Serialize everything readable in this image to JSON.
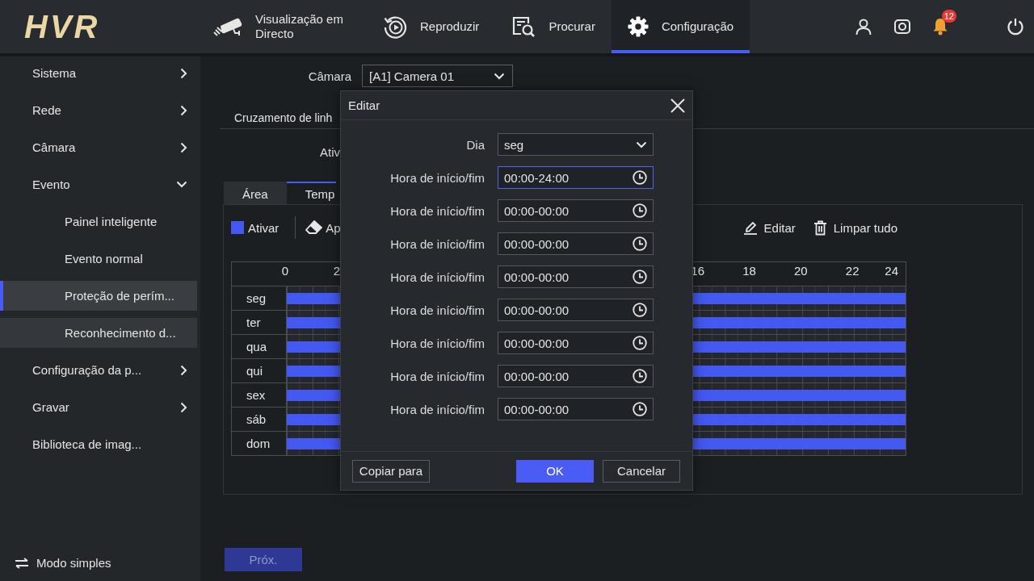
{
  "logo": "HVR",
  "nav": [
    {
      "label": "Visualização em Directo",
      "selected": false
    },
    {
      "label": "Reproduzir",
      "selected": false
    },
    {
      "label": "Procurar",
      "selected": false
    },
    {
      "label": "Configuração",
      "selected": true
    }
  ],
  "notifications": {
    "count": "12"
  },
  "sidebar": {
    "items": [
      {
        "label": "Sistema",
        "selected": false,
        "has_submenu": true,
        "expanded": false
      },
      {
        "label": "Rede",
        "selected": false,
        "has_submenu": true,
        "expanded": false
      },
      {
        "label": "Câmara",
        "selected": false,
        "has_submenu": true,
        "expanded": false
      },
      {
        "label": "Evento",
        "selected": false,
        "has_submenu": true,
        "expanded": true,
        "children": [
          {
            "label": "Painel inteligente",
            "selected": false,
            "hovered": false
          },
          {
            "label": "Evento normal",
            "selected": false,
            "hovered": false
          },
          {
            "label": "Proteção de perím...",
            "selected": true,
            "hovered": false
          },
          {
            "label": "Reconhecimento d...",
            "selected": false,
            "hovered": true
          }
        ]
      },
      {
        "label": "Configuração da p...",
        "selected": false,
        "has_submenu": true,
        "expanded": false
      },
      {
        "label": "Gravar",
        "selected": false,
        "has_submenu": true,
        "expanded": false
      },
      {
        "label": "Biblioteca de imag...",
        "selected": false,
        "has_submenu": false
      }
    ],
    "mode_switch": {
      "label": "Modo simples"
    }
  },
  "camera": {
    "label": "Câmara",
    "value": "[A1] Camera 01"
  },
  "rule": {
    "name": "Cruzamento de linh",
    "enable_label": "Ativ"
  },
  "schedule_tabs": [
    {
      "label": "Área",
      "selected": false
    },
    {
      "label": "Temp",
      "selected": true
    }
  ],
  "toolbar": {
    "tools": [
      {
        "label": "Ativar"
      },
      {
        "label": "Ap"
      }
    ],
    "actions": [
      {
        "label": "Editar"
      },
      {
        "label": "Limpar tudo"
      }
    ]
  },
  "schedule": {
    "left_ticks": [
      "0",
      "2"
    ],
    "right_ticks": [
      "16",
      "18",
      "20",
      "22",
      "24"
    ],
    "days": [
      {
        "label": "seg",
        "level": 1
      },
      {
        "label": "ter",
        "level": 1
      },
      {
        "label": "qua",
        "level": 1
      },
      {
        "label": "qui",
        "level": 1
      },
      {
        "label": "sex",
        "level": 1
      },
      {
        "label": "sáb",
        "level": 1
      },
      {
        "label": "dom",
        "level": 1
      }
    ]
  },
  "next_button": {
    "label": "Próx.",
    "disabled": true
  },
  "dialog": {
    "title": "Editar",
    "day": {
      "label": "Dia",
      "value": "seg"
    },
    "periods": [
      {
        "label": "Hora de início/fim",
        "value": "00:00-24:00",
        "focused": true
      },
      {
        "label": "Hora de início/fim",
        "value": "00:00-00:00",
        "focused": false
      },
      {
        "label": "Hora de início/fim",
        "value": "00:00-00:00",
        "focused": false
      },
      {
        "label": "Hora de início/fim",
        "value": "00:00-00:00",
        "focused": false
      },
      {
        "label": "Hora de início/fim",
        "value": "00:00-00:00",
        "focused": false
      },
      {
        "label": "Hora de início/fim",
        "value": "00:00-00:00",
        "focused": false
      },
      {
        "label": "Hora de início/fim",
        "value": "00:00-00:00",
        "focused": false
      },
      {
        "label": "Hora de início/fim",
        "value": "00:00-00:00",
        "focused": false
      }
    ],
    "buttons": [
      {
        "label": "Copiar para",
        "kind": "secondary"
      },
      {
        "label": "OK",
        "kind": "primary"
      },
      {
        "label": "Cancelar",
        "kind": "secondary"
      }
    ]
  }
}
